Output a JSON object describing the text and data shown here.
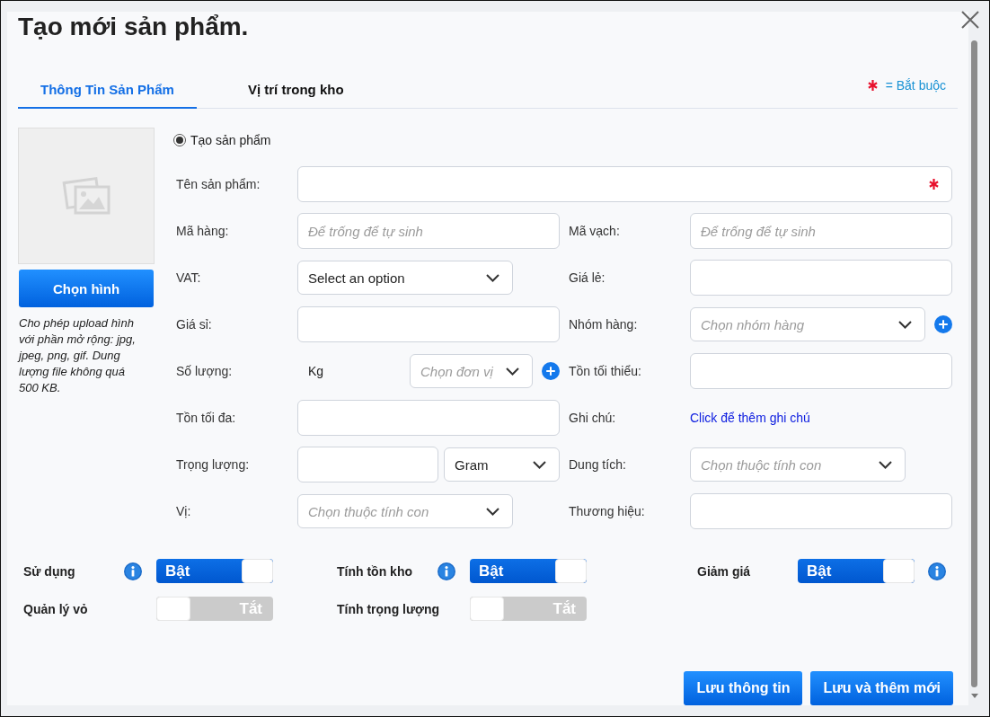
{
  "window": {
    "title": "Tạo mới sản phẩm."
  },
  "tabs": [
    {
      "label": "Thông Tin Sản Phẩm",
      "selected": true
    },
    {
      "label": "Vị trí trong kho",
      "selected": false
    }
  ],
  "required_legend": {
    "text": "= Bắt buộc"
  },
  "image_panel": {
    "button": "Chọn hình",
    "note": "Cho phép upload hình với phần mở rộng: jpg, jpeg, png, gif. Dung lượng file không quá 500 KB."
  },
  "mode": {
    "label": "Tạo sản phẩm",
    "selected": true
  },
  "rows": [
    [
      {
        "label": "Tên sản phẩm:",
        "kind": "text",
        "wide": true,
        "required": true
      }
    ],
    [
      {
        "label": "Mã hàng:",
        "kind": "text",
        "placeholder": "Để trống để tự sinh"
      },
      {
        "label": "Mã vạch:",
        "kind": "text",
        "placeholder": "Để trống để tự sinh"
      }
    ],
    [
      {
        "label": "VAT:",
        "kind": "select",
        "value": "Select an option"
      },
      {
        "label": "Giá lẻ:",
        "kind": "text"
      }
    ],
    [
      {
        "label": "Giá sỉ:",
        "kind": "text"
      },
      {
        "label": "Nhóm hàng:",
        "kind": "select",
        "placeholder": "Chọn nhóm hàng",
        "add": true
      }
    ],
    [
      {
        "label": "Số lượng:",
        "kind": "unit",
        "unit": "Kg",
        "placeholder": "Chọn đơn vị",
        "add": true
      },
      {
        "label": "Tồn tối thiểu:",
        "kind": "text"
      }
    ],
    [
      {
        "label": "Tồn tối đa:",
        "kind": "text"
      },
      {
        "label": "Ghi chú:",
        "kind": "link",
        "text": "Click để thêm ghi chú"
      }
    ],
    [
      {
        "label": "Trọng lượng:",
        "kind": "measure",
        "value": "Gram"
      },
      {
        "label": "Dung tích:",
        "kind": "select",
        "placeholder": "Chọn thuộc tính con"
      }
    ],
    [
      {
        "label": "Vị:",
        "kind": "select",
        "placeholder": "Chọn thuộc tính con"
      },
      {
        "label": "Thương hiệu:",
        "kind": "text"
      }
    ]
  ],
  "switches": [
    [
      {
        "label": "Sử dụng",
        "on": true,
        "text": "Bật",
        "info": true
      },
      {
        "label": "Tính tồn kho",
        "on": true,
        "text": "Bật",
        "info": true
      },
      {
        "label": "Giảm giá",
        "on": true,
        "text": "Bật",
        "info": true
      }
    ],
    [
      {
        "label": "Quản lý vỏ",
        "on": false,
        "text": "Tắt"
      },
      {
        "label": "Tính trọng lượng",
        "on": false,
        "text": "Tắt"
      }
    ]
  ],
  "actions": [
    "Lưu thông tin",
    "Lưu và thêm mới"
  ]
}
